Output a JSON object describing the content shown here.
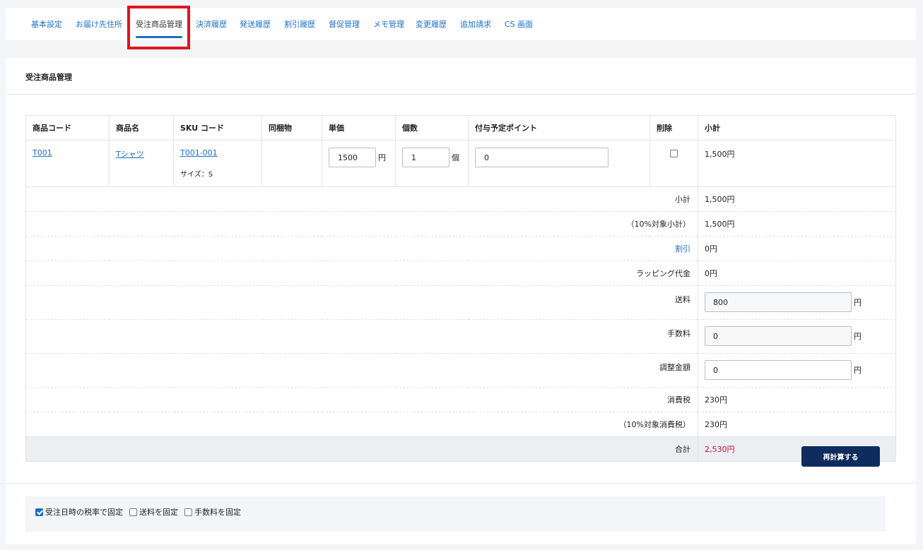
{
  "tabs": [
    {
      "label": "基本設定"
    },
    {
      "label": "お届け先住所"
    },
    {
      "label": "受注商品管理"
    },
    {
      "label": "決済履歴"
    },
    {
      "label": "発送履歴"
    },
    {
      "label": "割引履歴"
    },
    {
      "label": "督促管理"
    },
    {
      "label": "メモ管理"
    },
    {
      "label": "変更履歴"
    },
    {
      "label": "追加請求"
    },
    {
      "label": "CS 画面"
    }
  ],
  "active_tab": "受注商品管理",
  "section_title": "受注商品管理",
  "table": {
    "headers": [
      "商品コード",
      "商品名",
      "SKU コード",
      "同梱物",
      "単価",
      "個数",
      "付与予定ポイント",
      "削除",
      "小計"
    ],
    "rows": [
      {
        "product_code": "T001",
        "product_name": "Tシャツ",
        "sku_code": "T001-001",
        "sku_variant": "サイズ：S",
        "bundle": "",
        "unit_price": "1500",
        "unit_price_suffix": "円",
        "quantity": "1",
        "quantity_suffix": "個",
        "points": "0",
        "delete_checked": false,
        "subtotal": "1,500円"
      }
    ]
  },
  "summary": {
    "subtotal_label": "小計",
    "subtotal_value": "1,500円",
    "tax10_subtotal_label": "（10%対象小計）",
    "tax10_subtotal_value": "1,500円",
    "discount_label": "割引",
    "discount_value": "0円",
    "wrapping_label": "ラッピング代金",
    "wrapping_value": "0円",
    "shipping_label": "送料",
    "shipping_value": "800",
    "fee_label": "手数料",
    "fee_value": "0",
    "adjust_label": "調整金額",
    "adjust_value": "0",
    "yen": "円",
    "consumption_tax_label": "消費税",
    "consumption_tax_value": "230円",
    "tax10_consumption_label": "（10%対象消費税）",
    "tax10_consumption_value": "230円",
    "total_label": "合計",
    "total_value": "2,530円"
  },
  "footer": {
    "options": [
      {
        "label": "受注日時の税率で固定",
        "checked": true
      },
      {
        "label": "送料を固定",
        "checked": false
      },
      {
        "label": "手数料を固定",
        "checked": false
      }
    ],
    "recalc_button": "再計算する"
  },
  "colors": {
    "accent": "#1a6fc9",
    "highlight": "#e1141f",
    "total_text": "#c8102e",
    "button_bg": "#0e2d5e"
  }
}
